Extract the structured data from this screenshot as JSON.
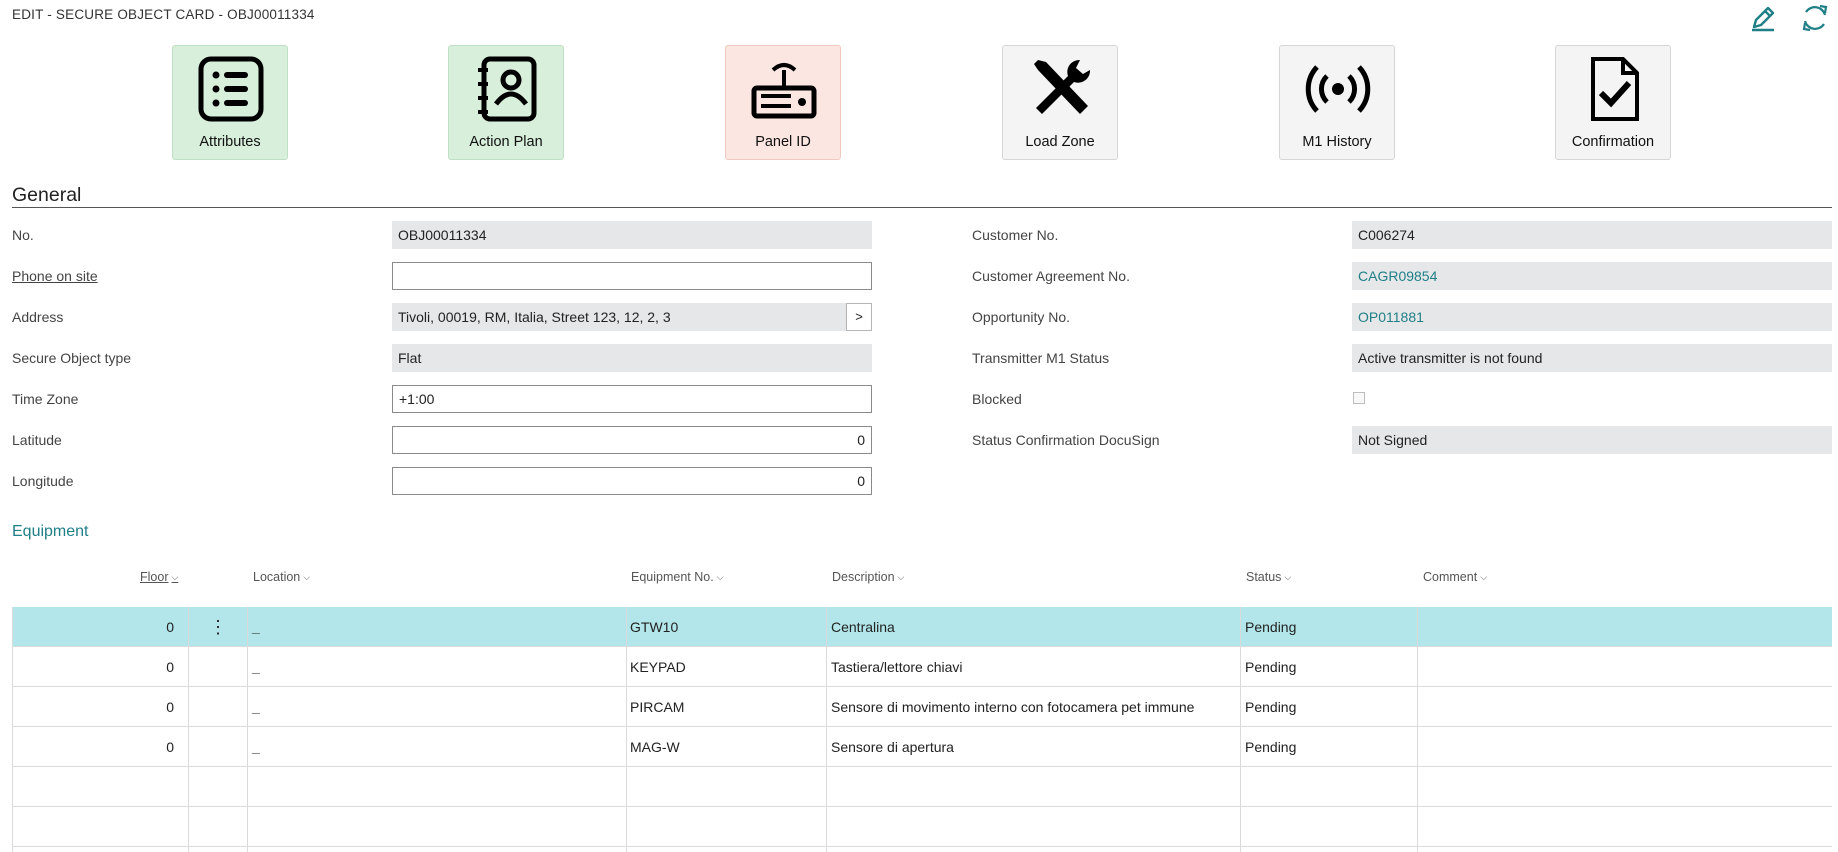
{
  "window": {
    "title": "EDIT - SECURE OBJECT CARD - OBJ00011334"
  },
  "toolbar": {
    "edit_icon": "pencil-icon",
    "refresh_icon": "refresh-icon"
  },
  "actions": [
    {
      "label": "Attributes",
      "icon": "list-icon"
    },
    {
      "label": "Action Plan",
      "icon": "contact-book-icon"
    },
    {
      "label": "Panel ID",
      "icon": "router-icon"
    },
    {
      "label": "Load Zone",
      "icon": "tools-icon"
    },
    {
      "label": "M1 History",
      "icon": "broadcast-icon"
    },
    {
      "label": "Confirmation",
      "icon": "document-check-icon"
    }
  ],
  "general": {
    "title": "General",
    "left": [
      {
        "label": "No.",
        "value": "OBJ00011334"
      },
      {
        "label": "Phone on site",
        "value": ""
      },
      {
        "label": "Address",
        "value": "Tivoli, 00019, RM, Italia, Street 123, 12, 2, 3",
        "assist": ">"
      },
      {
        "label": "Secure Object type",
        "value": "Flat"
      },
      {
        "label": "Time Zone",
        "value": "+1:00"
      },
      {
        "label": "Latitude",
        "value": "0"
      },
      {
        "label": "Longitude",
        "value": "0"
      }
    ],
    "right": [
      {
        "label": "Customer No.",
        "value": "C006274"
      },
      {
        "label": "Customer Agreement No.",
        "value": "CAGR09854"
      },
      {
        "label": "Opportunity No.",
        "value": "OP011881"
      },
      {
        "label": "Transmitter M1 Status",
        "value": "Active transmitter is not found"
      },
      {
        "label": "Blocked",
        "value": ""
      },
      {
        "label": "Status Confirmation DocuSign",
        "value": "Not Signed"
      }
    ]
  },
  "equipment": {
    "title": "Equipment",
    "columns": [
      "Floor",
      "Location",
      "Equipment No.",
      "Description",
      "Status",
      "Comment"
    ],
    "rows": [
      {
        "floor": "0",
        "location": "_",
        "equipment_no": "GTW10",
        "description": "Centralina",
        "status": "Pending",
        "comment": ""
      },
      {
        "floor": "0",
        "location": "_",
        "equipment_no": "KEYPAD",
        "description": "Tastiera/lettore chiavi",
        "status": "Pending",
        "comment": ""
      },
      {
        "floor": "0",
        "location": "_",
        "equipment_no": "PIRCAM",
        "description": "Sensore di movimento interno con fotocamera pet immune",
        "status": "Pending",
        "comment": ""
      },
      {
        "floor": "0",
        "location": "_",
        "equipment_no": "MAG-W",
        "description": "Sensore di apertura",
        "status": "Pending",
        "comment": ""
      }
    ],
    "row_menu": "⋮"
  },
  "colors": {
    "accent": "#1f7f87",
    "selected_row": "#b3e6ea",
    "tile_green": "#d7efdb",
    "tile_pink": "#fce6e1"
  }
}
